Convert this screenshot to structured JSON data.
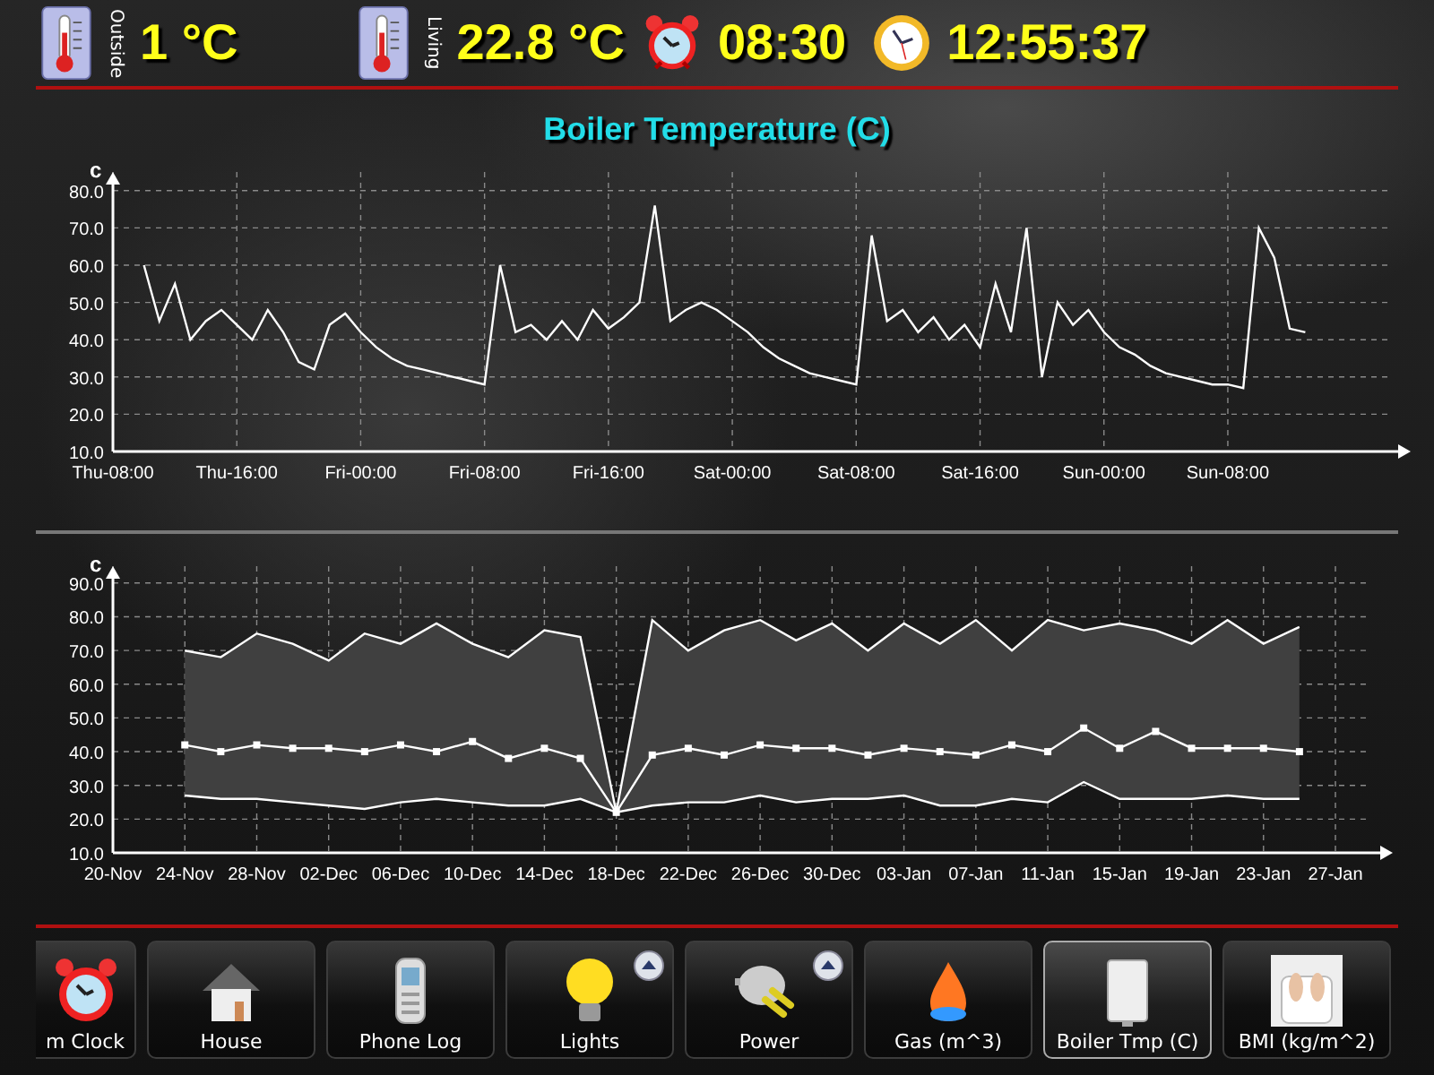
{
  "header": {
    "readings": [
      {
        "kind": "thermometer",
        "label": "Outside",
        "value": "1 °C"
      },
      {
        "kind": "thermometer",
        "label": "Living",
        "value": "22.8 °C"
      },
      {
        "kind": "alarm",
        "value": "08:30"
      },
      {
        "kind": "clock",
        "value": "12:55:37"
      }
    ]
  },
  "title": "Boiler Temperature (C)",
  "charts": [
    {
      "chart_data": {
        "type": "line",
        "grid": true,
        "ylabel": "c",
        "ylim": [
          10,
          85
        ],
        "yticks": [
          {
            "value": 10,
            "label": "10.0"
          },
          {
            "value": 20,
            "label": "20.0"
          },
          {
            "value": 30,
            "label": "30.0"
          },
          {
            "value": 40,
            "label": "40.0"
          },
          {
            "value": 50,
            "label": "50.0"
          },
          {
            "value": 60,
            "label": "60.0"
          },
          {
            "value": 70,
            "label": "70.0"
          },
          {
            "value": 80,
            "label": "80.0"
          }
        ],
        "categories": [
          "Thu-08:00",
          null,
          null,
          null,
          null,
          null,
          null,
          null,
          "Thu-16:00",
          null,
          null,
          null,
          null,
          null,
          null,
          null,
          "Fri-00:00",
          null,
          null,
          null,
          null,
          null,
          null,
          null,
          "Fri-08:00",
          null,
          null,
          null,
          null,
          null,
          null,
          null,
          "Fri-16:00",
          null,
          null,
          null,
          null,
          null,
          null,
          null,
          "Sat-00:00",
          null,
          null,
          null,
          null,
          null,
          null,
          null,
          "Sat-08:00",
          null,
          null,
          null,
          null,
          null,
          null,
          null,
          "Sat-16:00",
          null,
          null,
          null,
          null,
          null,
          null,
          null,
          "Sun-00:00",
          null,
          null,
          null,
          null,
          null,
          null,
          null,
          "Sun-08:00",
          null,
          null,
          null,
          null,
          null,
          null,
          null,
          null,
          null,
          null,
          null
        ],
        "series": [
          {
            "color": "#ffffff",
            "values": [
              null,
              null,
              60,
              45,
              55,
              40,
              45,
              48,
              44,
              40,
              48,
              42,
              34,
              32,
              44,
              47,
              42,
              38,
              35,
              33,
              32,
              31,
              30,
              29,
              28,
              60,
              42,
              44,
              40,
              45,
              40,
              48,
              43,
              46,
              50,
              76,
              45,
              48,
              50,
              48,
              45,
              42,
              38,
              35,
              33,
              31,
              30,
              29,
              28,
              68,
              45,
              48,
              42,
              46,
              40,
              44,
              38,
              55,
              42,
              70,
              30,
              50,
              44,
              48,
              42,
              38,
              36,
              33,
              31,
              30,
              29,
              28,
              28,
              27,
              70,
              62,
              43,
              42,
              null,
              null,
              null,
              null,
              null,
              null
            ]
          }
        ]
      }
    },
    {
      "chart_data": {
        "type": "line",
        "grid": true,
        "ylabel": "c",
        "ylim": [
          10,
          95
        ],
        "yticks": [
          {
            "value": 10,
            "label": "10.0"
          },
          {
            "value": 20,
            "label": "20.0"
          },
          {
            "value": 30,
            "label": "30.0"
          },
          {
            "value": 40,
            "label": "40.0"
          },
          {
            "value": 50,
            "label": "50.0"
          },
          {
            "value": 60,
            "label": "60.0"
          },
          {
            "value": 70,
            "label": "70.0"
          },
          {
            "value": 80,
            "label": "80.0"
          },
          {
            "value": 90,
            "label": "90.0"
          }
        ],
        "categories": [
          "20-Nov",
          null,
          "24-Nov",
          null,
          "28-Nov",
          null,
          "02-Dec",
          null,
          "06-Dec",
          null,
          "10-Dec",
          null,
          "14-Dec",
          null,
          "18-Dec",
          null,
          "22-Dec",
          null,
          "26-Dec",
          null,
          "30-Dec",
          null,
          "03-Jan",
          null,
          "07-Jan",
          null,
          "11-Jan",
          null,
          "15-Jan",
          null,
          "19-Jan",
          null,
          "23-Jan",
          null,
          "27-Jan"
        ],
        "series": [
          {
            "type": "area",
            "color": "#ffffff",
            "values": [
              null,
              null,
              70,
              68,
              75,
              72,
              67,
              75,
              72,
              78,
              72,
              68,
              76,
              74,
              22,
              79,
              70,
              76,
              79,
              73,
              78,
              70,
              78,
              72,
              79,
              70,
              79,
              76,
              78,
              76,
              72,
              79,
              72,
              77,
              null
            ]
          },
          {
            "type": "line",
            "marker": true,
            "color": "#ffffff",
            "values": [
              null,
              null,
              42,
              40,
              42,
              41,
              41,
              40,
              42,
              40,
              43,
              38,
              41,
              38,
              22,
              39,
              41,
              39,
              42,
              41,
              41,
              39,
              41,
              40,
              39,
              42,
              40,
              47,
              41,
              46,
              41,
              41,
              41,
              40,
              null
            ]
          },
          {
            "type": "line",
            "color": "#ffffff",
            "values": [
              null,
              null,
              27,
              26,
              26,
              25,
              24,
              23,
              25,
              26,
              25,
              24,
              24,
              26,
              22,
              24,
              25,
              25,
              27,
              25,
              26,
              26,
              27,
              24,
              24,
              26,
              25,
              31,
              26,
              26,
              26,
              27,
              26,
              26,
              null
            ]
          }
        ]
      }
    }
  ],
  "tiles": [
    {
      "kind": "alarm",
      "label": "m Clock",
      "selected": false,
      "has_menu": false
    },
    {
      "kind": "house",
      "label": "House",
      "selected": false,
      "has_menu": false
    },
    {
      "kind": "phone",
      "label": "Phone Log",
      "selected": false,
      "has_menu": false
    },
    {
      "kind": "bulb",
      "label": "Lights",
      "selected": false,
      "has_menu": true
    },
    {
      "kind": "plug",
      "label": "Power",
      "selected": false,
      "has_menu": true
    },
    {
      "kind": "flame",
      "label": "Gas (m^3)",
      "selected": false,
      "has_menu": false
    },
    {
      "kind": "boiler",
      "label": "Boiler Tmp (C)",
      "selected": true,
      "has_menu": false
    },
    {
      "kind": "scale",
      "label": "BMI (kg/m^2)",
      "selected": false,
      "has_menu": false
    }
  ]
}
